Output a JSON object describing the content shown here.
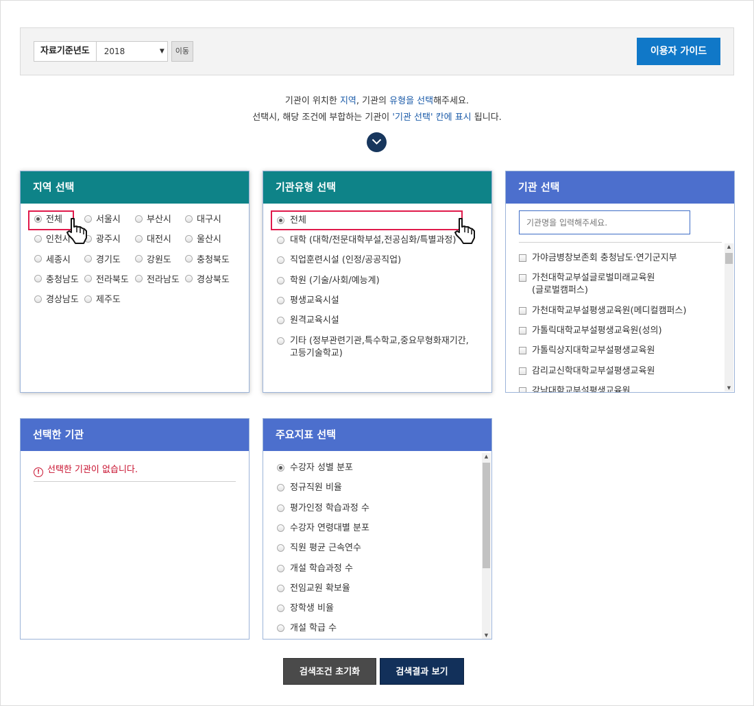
{
  "top": {
    "year_label": "자료기준년도",
    "year_value": "2018",
    "move_label": "이동",
    "guide_label": "이용자 가이드"
  },
  "intro": {
    "l1_a": "기관이 위치한 ",
    "l1_b": "지역",
    "l1_c": ", 기관의 ",
    "l1_d": "유형을 선택",
    "l1_e": "해주세요.",
    "l2_a": "선택시, 해당 조건에 부합하는 기관이 ",
    "l2_b": "'기관 선택' 칸에 표시",
    "l2_c": " 됩니다."
  },
  "region": {
    "title": "지역 선택",
    "options": [
      "전체",
      "서울시",
      "부산시",
      "대구시",
      "인천시",
      "광주시",
      "대전시",
      "울산시",
      "세종시",
      "경기도",
      "강원도",
      "충청북도",
      "충청남도",
      "전라북도",
      "전라남도",
      "경상북도",
      "경상남도",
      "제주도"
    ],
    "selected": "전체"
  },
  "type": {
    "title": "기관유형 선택",
    "options": [
      "전체",
      "대학 (대학/전문대학부설,전공심화/특별과정)",
      "직업훈련시설 (인정/공공직업)",
      "학원 (기술/사회/예능계)",
      "평생교육시설",
      "원격교육시설",
      "기타 (정부관련기관,특수학교,중요무형화재기간,",
      "고등기술학교)"
    ],
    "selected": "전체"
  },
  "inst": {
    "title": "기관 선택",
    "placeholder": "기관명을 입력해주세요.",
    "items": [
      "가야금병창보존회 충청남도·연기군지부",
      "가천대학교부설글로벌미래교육원",
      "(글로벌캠퍼스)",
      "가천대학교부설평생교육원(메디컬캠퍼스)",
      "가톨릭대학교부설평생교육원(성의)",
      "가톨릭상지대학교부설평생교육원",
      "감리교신학대학교부설평생교육원",
      "강남대학교부설평생교육원"
    ]
  },
  "selected_inst": {
    "title": "선택한 기관",
    "empty": "선택한 기관이 없습니다."
  },
  "indicator": {
    "title": "주요지표 선택",
    "options": [
      "수강자 성별 분포",
      "정규직원 비율",
      "평가인정 학습과정 수",
      "수강자 연령대별 분포",
      "직원 평균 근속연수",
      "개설 학습과정 수",
      "전임교원 확보율",
      "장학생 비율",
      "개설 학급 수"
    ],
    "selected": "수강자 성별 분포"
  },
  "buttons": {
    "reset": "검색조건 초기화",
    "show": "검색결과 보기"
  },
  "colors": {
    "teal": "#0e8388",
    "blue": "#4c6fcd",
    "navy": "#12305a",
    "guide": "#1078c8",
    "highlight": "#e0194a"
  }
}
